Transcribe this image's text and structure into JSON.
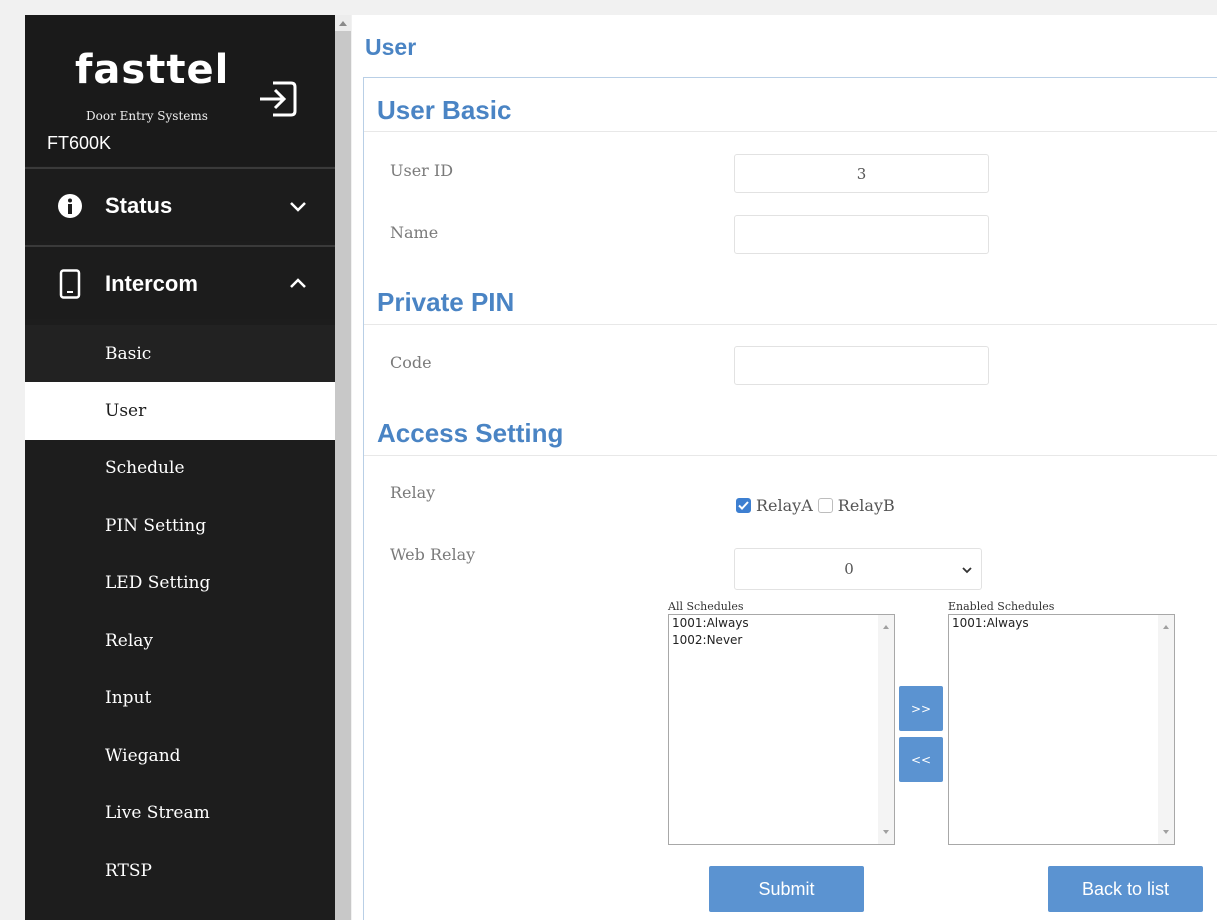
{
  "brand": {
    "logo_text": "fasttel",
    "tagline": "Door Entry Systems",
    "model": "FT600K"
  },
  "icons": {
    "logout": "logout-icon",
    "status": "info-circle-icon",
    "intercom": "phone-icon",
    "collapse": "chevron-down-icon",
    "expand": "chevron-up-icon"
  },
  "colors": {
    "accent": "#4a84c4",
    "button": "#5b93d1",
    "sidebar": "#1d1d1d",
    "checkbox": "#3d7fd1"
  },
  "sidebar": {
    "status_label": "Status",
    "intercom_label": "Intercom",
    "items": [
      {
        "label": "Basic"
      },
      {
        "label": "User"
      },
      {
        "label": "Schedule"
      },
      {
        "label": "PIN Setting"
      },
      {
        "label": "LED Setting"
      },
      {
        "label": "Relay"
      },
      {
        "label": "Input"
      },
      {
        "label": "Wiegand"
      },
      {
        "label": "Live Stream"
      },
      {
        "label": "RTSP"
      }
    ],
    "active_item": "User"
  },
  "page": {
    "title": "User"
  },
  "sections": {
    "user_basic": "User Basic",
    "private_pin": "Private PIN",
    "access_setting": "Access Setting"
  },
  "fields": {
    "user_id": {
      "label": "User ID",
      "value": "3"
    },
    "name": {
      "label": "Name",
      "value": ""
    },
    "code": {
      "label": "Code",
      "value": ""
    },
    "relay": {
      "label": "Relay",
      "options": [
        {
          "label": "RelayA",
          "checked": true
        },
        {
          "label": "RelayB",
          "checked": false
        }
      ]
    },
    "web_relay": {
      "label": "Web Relay",
      "value": "0"
    }
  },
  "schedules": {
    "all_label": "All Schedules",
    "enabled_label": "Enabled Schedules",
    "all": [
      "1001:Always",
      "1002:Never"
    ],
    "enabled": [
      "1001:Always"
    ],
    "add_label": ">>",
    "remove_label": "<<"
  },
  "actions": {
    "submit": "Submit",
    "back": "Back to list"
  }
}
